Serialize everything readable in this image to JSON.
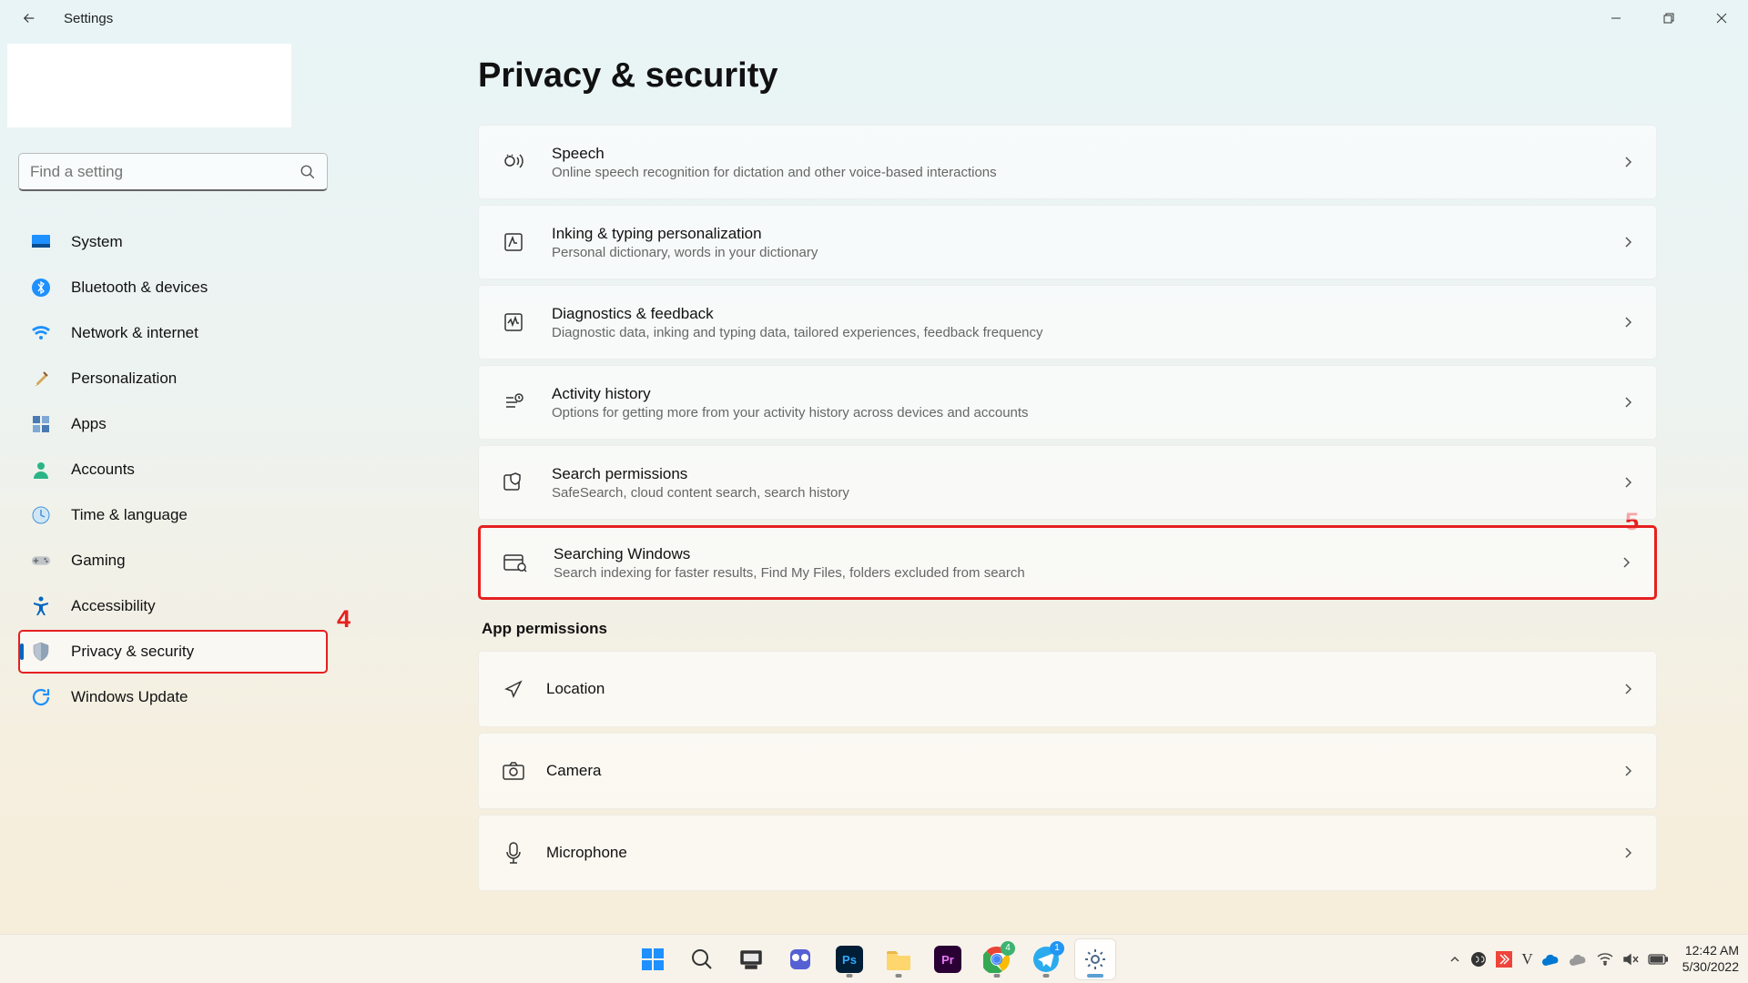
{
  "window": {
    "title": "Settings"
  },
  "search": {
    "placeholder": "Find a setting"
  },
  "sidebar": {
    "items": [
      {
        "id": "system",
        "label": "System"
      },
      {
        "id": "bluetooth",
        "label": "Bluetooth & devices"
      },
      {
        "id": "network",
        "label": "Network & internet"
      },
      {
        "id": "personalization",
        "label": "Personalization"
      },
      {
        "id": "apps",
        "label": "Apps"
      },
      {
        "id": "accounts",
        "label": "Accounts"
      },
      {
        "id": "time",
        "label": "Time & language"
      },
      {
        "id": "gaming",
        "label": "Gaming"
      },
      {
        "id": "accessibility",
        "label": "Accessibility"
      },
      {
        "id": "privacy",
        "label": "Privacy & security"
      },
      {
        "id": "update",
        "label": "Windows Update"
      }
    ]
  },
  "page": {
    "title": "Privacy & security",
    "settings": [
      {
        "id": "speech",
        "title": "Speech",
        "desc": "Online speech recognition for dictation and other voice-based interactions"
      },
      {
        "id": "inking",
        "title": "Inking & typing personalization",
        "desc": "Personal dictionary, words in your dictionary"
      },
      {
        "id": "diag",
        "title": "Diagnostics & feedback",
        "desc": "Diagnostic data, inking and typing data, tailored experiences, feedback frequency"
      },
      {
        "id": "activity",
        "title": "Activity history",
        "desc": "Options for getting more from your activity history across devices and accounts"
      },
      {
        "id": "searchperm",
        "title": "Search permissions",
        "desc": "SafeSearch, cloud content search, search history"
      },
      {
        "id": "searchwin",
        "title": "Searching Windows",
        "desc": "Search indexing for faster results, Find My Files, folders excluded from search"
      }
    ],
    "section_header": "App permissions",
    "perms": [
      {
        "id": "location",
        "title": "Location"
      },
      {
        "id": "camera",
        "title": "Camera"
      },
      {
        "id": "microphone",
        "title": "Microphone"
      }
    ]
  },
  "annotations": {
    "sidebar_num": "4",
    "card_num": "5"
  },
  "taskbar": {
    "apps": [
      {
        "id": "start",
        "name": "start"
      },
      {
        "id": "search",
        "name": "search"
      },
      {
        "id": "taskview",
        "name": "task-view"
      },
      {
        "id": "chat",
        "name": "chat"
      },
      {
        "id": "ps",
        "name": "photoshop"
      },
      {
        "id": "explorer",
        "name": "file-explorer"
      },
      {
        "id": "pr",
        "name": "premiere"
      },
      {
        "id": "chrome",
        "name": "chrome",
        "badge": "4",
        "badge_color": "#3cb371"
      },
      {
        "id": "telegram",
        "name": "telegram",
        "badge": "1",
        "badge_color": "#2196f3"
      },
      {
        "id": "settings",
        "name": "settings",
        "active": true
      }
    ],
    "clock": {
      "time": "12:42 AM",
      "date": "5/30/2022"
    }
  }
}
